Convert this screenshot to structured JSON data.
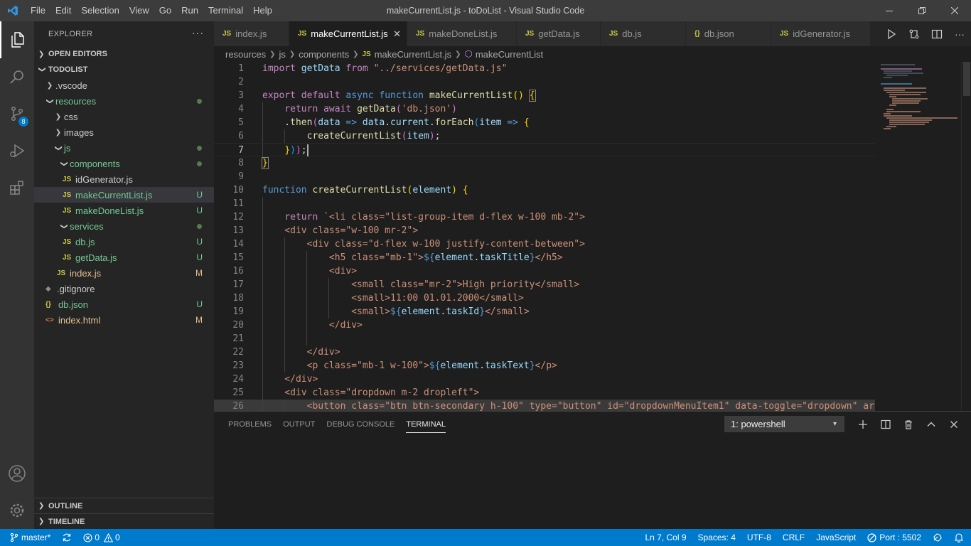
{
  "title_bar": {
    "menu": [
      "File",
      "Edit",
      "Selection",
      "View",
      "Go",
      "Run",
      "Terminal",
      "Help"
    ],
    "window_title": "makeCurrentList.js - toDoList - Visual Studio Code"
  },
  "activity_bar": {
    "source_control_badge": "8"
  },
  "sidebar": {
    "header": "EXPLORER",
    "more": "···",
    "open_editors": "OPEN EDITORS",
    "project": "TODOLIST",
    "tree": [
      {
        "label": ".vscode",
        "type": "folder",
        "expanded": false,
        "status": ""
      },
      {
        "label": "resources",
        "type": "folder",
        "expanded": true,
        "status": "dot"
      },
      {
        "label": "css",
        "type": "folder",
        "expanded": false,
        "status": ""
      },
      {
        "label": "images",
        "type": "folder",
        "expanded": false,
        "status": ""
      },
      {
        "label": "js",
        "type": "folder",
        "expanded": true,
        "status": "dot"
      },
      {
        "label": "components",
        "type": "folder",
        "expanded": true,
        "status": "dot"
      },
      {
        "label": "idGenerator.js",
        "type": "js",
        "status": ""
      },
      {
        "label": "makeCurrentList.js",
        "type": "js",
        "status": "U"
      },
      {
        "label": "makeDoneList.js",
        "type": "js",
        "status": "U"
      },
      {
        "label": "services",
        "type": "folder",
        "expanded": true,
        "status": "dot"
      },
      {
        "label": "db.js",
        "type": "js",
        "status": "U"
      },
      {
        "label": "getData.js",
        "type": "js",
        "status": "U"
      },
      {
        "label": "index.js",
        "type": "js",
        "status": "M"
      },
      {
        "label": ".gitignore",
        "type": "git",
        "status": ""
      },
      {
        "label": "db.json",
        "type": "json",
        "status": "U"
      },
      {
        "label": "index.html",
        "type": "html",
        "status": "M"
      }
    ],
    "outline": "OUTLINE",
    "timeline": "TIMELINE"
  },
  "editor": {
    "tabs": [
      {
        "label": "index.js",
        "icon": "JS"
      },
      {
        "label": "makeCurrentList.js",
        "icon": "JS",
        "close": "✕"
      },
      {
        "label": "makeDoneList.js",
        "icon": "JS"
      },
      {
        "label": "getData.js",
        "icon": "JS"
      },
      {
        "label": "db.js",
        "icon": "JS"
      },
      {
        "label": "db.json",
        "icon": "{}"
      },
      {
        "label": "idGenerator.js",
        "icon": "JS"
      }
    ],
    "breadcrumb": [
      "resources",
      "js",
      "components",
      "makeCurrentList.js",
      "makeCurrentList"
    ],
    "line_numbers": [
      "1",
      "2",
      "3",
      "4",
      "5",
      "6",
      "7",
      "8",
      "9",
      "10",
      "11",
      "12",
      "13",
      "14",
      "15",
      "16",
      "17",
      "18",
      "19",
      "20",
      "21",
      "22",
      "23",
      "24",
      "25",
      "26"
    ]
  },
  "panel": {
    "tabs": [
      "PROBLEMS",
      "OUTPUT",
      "DEBUG CONSOLE",
      "TERMINAL"
    ],
    "terminal_select": "1: powershell"
  },
  "status_bar": {
    "branch": "master*",
    "errors": "0",
    "warnings": "0",
    "position": "Ln 7, Col 9",
    "spaces": "Spaces: 4",
    "encoding": "UTF-8",
    "eol": "CRLF",
    "language": "JavaScript",
    "port": "Port : 5502"
  }
}
